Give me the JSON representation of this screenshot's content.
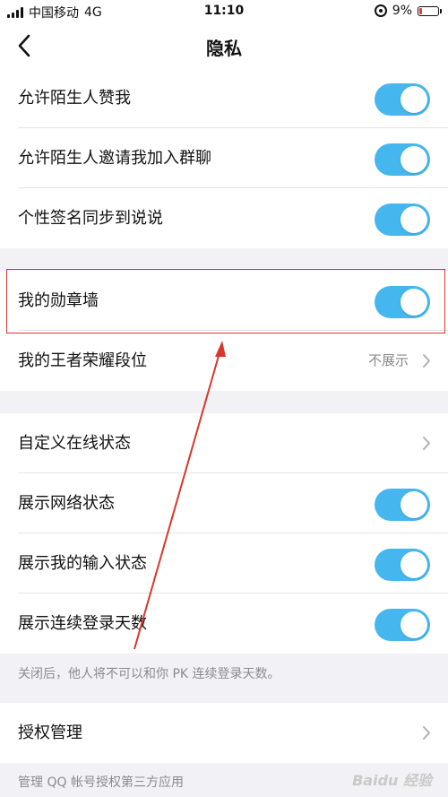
{
  "status_bar": {
    "carrier": "中国移动",
    "network": "4G",
    "time": "11:10",
    "battery": "9%"
  },
  "nav": {
    "title": "隐私"
  },
  "group1": [
    {
      "label": "允许陌生人赞我",
      "on": true
    },
    {
      "label": "允许陌生人邀请我加入群聊",
      "on": true
    },
    {
      "label": "个性签名同步到说说",
      "on": true
    }
  ],
  "group2": [
    {
      "label": "我的勋章墙",
      "on": true
    },
    {
      "label": "我的王者荣耀段位",
      "value": "不展示"
    }
  ],
  "group3": [
    {
      "label": "自定义在线状态"
    },
    {
      "label": "展示网络状态",
      "on": true
    },
    {
      "label": "展示我的输入状态",
      "on": true
    },
    {
      "label": "展示连续登录天数",
      "on": true
    }
  ],
  "hint1": "关闭后，他人将不可以和你 PK 连续登录天数。",
  "group4": [
    {
      "label": "授权管理"
    }
  ],
  "hint2": "管理 QQ 帐号授权第三方应用",
  "watermark": "Baidu 经验",
  "colors": {
    "toggle_on": "#45b7ee",
    "highlight": "#d8372d"
  }
}
